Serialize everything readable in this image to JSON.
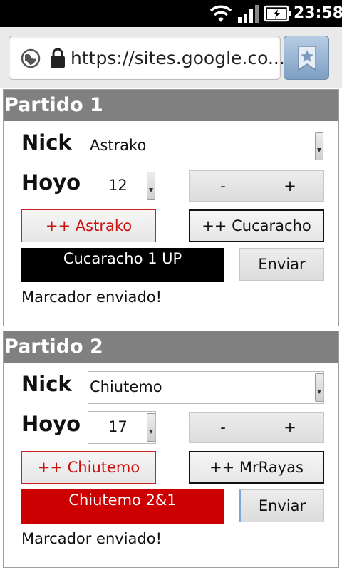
{
  "status_bar": {
    "time": "23:58",
    "icons": [
      "wifi-icon",
      "signal-icon",
      "battery-charging-icon"
    ]
  },
  "browser": {
    "url": "https://sites.google.co...",
    "icons": [
      "globe-icon",
      "lock-icon",
      "bookmark-star-icon"
    ]
  },
  "colors": {
    "header": "#808080",
    "score_1_bg": "#000000",
    "score_2_bg": "#cc0000",
    "accent_red": "#cc1111"
  },
  "matches": [
    {
      "title": "Partido 1",
      "nick_label": "Nick",
      "nick_value": "Astrako",
      "hole_label": "Hoyo",
      "hole_value": "12",
      "minus_label": "-",
      "plus_label": "+",
      "player1_button": "++ Astrako",
      "player2_button": "++ Cucaracho",
      "score_text": "Cucaracho 1 UP",
      "send_label": "Enviar",
      "status": "Marcador enviado!"
    },
    {
      "title": "Partido 2",
      "nick_label": "Nick",
      "nick_value": "Chiutemo",
      "hole_label": "Hoyo",
      "hole_value": "17",
      "minus_label": "-",
      "plus_label": "+",
      "player1_button": "++ Chiutemo",
      "player2_button": "++ MrRayas",
      "score_text": "Chiutemo 2&1",
      "send_label": "Enviar",
      "status": "Marcador enviado!"
    }
  ]
}
